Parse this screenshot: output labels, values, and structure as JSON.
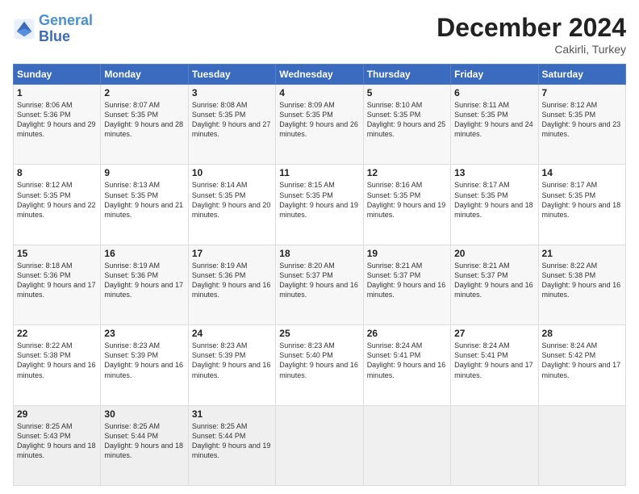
{
  "logo": {
    "line1": "General",
    "line2": "Blue"
  },
  "title": "December 2024",
  "subtitle": "Cakirli, Turkey",
  "days_header": [
    "Sunday",
    "Monday",
    "Tuesday",
    "Wednesday",
    "Thursday",
    "Friday",
    "Saturday"
  ],
  "weeks": [
    [
      {
        "day": "1",
        "sunrise": "Sunrise: 8:06 AM",
        "sunset": "Sunset: 5:36 PM",
        "daylight": "Daylight: 9 hours and 29 minutes."
      },
      {
        "day": "2",
        "sunrise": "Sunrise: 8:07 AM",
        "sunset": "Sunset: 5:35 PM",
        "daylight": "Daylight: 9 hours and 28 minutes."
      },
      {
        "day": "3",
        "sunrise": "Sunrise: 8:08 AM",
        "sunset": "Sunset: 5:35 PM",
        "daylight": "Daylight: 9 hours and 27 minutes."
      },
      {
        "day": "4",
        "sunrise": "Sunrise: 8:09 AM",
        "sunset": "Sunset: 5:35 PM",
        "daylight": "Daylight: 9 hours and 26 minutes."
      },
      {
        "day": "5",
        "sunrise": "Sunrise: 8:10 AM",
        "sunset": "Sunset: 5:35 PM",
        "daylight": "Daylight: 9 hours and 25 minutes."
      },
      {
        "day": "6",
        "sunrise": "Sunrise: 8:11 AM",
        "sunset": "Sunset: 5:35 PM",
        "daylight": "Daylight: 9 hours and 24 minutes."
      },
      {
        "day": "7",
        "sunrise": "Sunrise: 8:12 AM",
        "sunset": "Sunset: 5:35 PM",
        "daylight": "Daylight: 9 hours and 23 minutes."
      }
    ],
    [
      {
        "day": "8",
        "sunrise": "Sunrise: 8:12 AM",
        "sunset": "Sunset: 5:35 PM",
        "daylight": "Daylight: 9 hours and 22 minutes."
      },
      {
        "day": "9",
        "sunrise": "Sunrise: 8:13 AM",
        "sunset": "Sunset: 5:35 PM",
        "daylight": "Daylight: 9 hours and 21 minutes."
      },
      {
        "day": "10",
        "sunrise": "Sunrise: 8:14 AM",
        "sunset": "Sunset: 5:35 PM",
        "daylight": "Daylight: 9 hours and 20 minutes."
      },
      {
        "day": "11",
        "sunrise": "Sunrise: 8:15 AM",
        "sunset": "Sunset: 5:35 PM",
        "daylight": "Daylight: 9 hours and 19 minutes."
      },
      {
        "day": "12",
        "sunrise": "Sunrise: 8:16 AM",
        "sunset": "Sunset: 5:35 PM",
        "daylight": "Daylight: 9 hours and 19 minutes."
      },
      {
        "day": "13",
        "sunrise": "Sunrise: 8:17 AM",
        "sunset": "Sunset: 5:35 PM",
        "daylight": "Daylight: 9 hours and 18 minutes."
      },
      {
        "day": "14",
        "sunrise": "Sunrise: 8:17 AM",
        "sunset": "Sunset: 5:35 PM",
        "daylight": "Daylight: 9 hours and 18 minutes."
      }
    ],
    [
      {
        "day": "15",
        "sunrise": "Sunrise: 8:18 AM",
        "sunset": "Sunset: 5:36 PM",
        "daylight": "Daylight: 9 hours and 17 minutes."
      },
      {
        "day": "16",
        "sunrise": "Sunrise: 8:19 AM",
        "sunset": "Sunset: 5:36 PM",
        "daylight": "Daylight: 9 hours and 17 minutes."
      },
      {
        "day": "17",
        "sunrise": "Sunrise: 8:19 AM",
        "sunset": "Sunset: 5:36 PM",
        "daylight": "Daylight: 9 hours and 16 minutes."
      },
      {
        "day": "18",
        "sunrise": "Sunrise: 8:20 AM",
        "sunset": "Sunset: 5:37 PM",
        "daylight": "Daylight: 9 hours and 16 minutes."
      },
      {
        "day": "19",
        "sunrise": "Sunrise: 8:21 AM",
        "sunset": "Sunset: 5:37 PM",
        "daylight": "Daylight: 9 hours and 16 minutes."
      },
      {
        "day": "20",
        "sunrise": "Sunrise: 8:21 AM",
        "sunset": "Sunset: 5:37 PM",
        "daylight": "Daylight: 9 hours and 16 minutes."
      },
      {
        "day": "21",
        "sunrise": "Sunrise: 8:22 AM",
        "sunset": "Sunset: 5:38 PM",
        "daylight": "Daylight: 9 hours and 16 minutes."
      }
    ],
    [
      {
        "day": "22",
        "sunrise": "Sunrise: 8:22 AM",
        "sunset": "Sunset: 5:38 PM",
        "daylight": "Daylight: 9 hours and 16 minutes."
      },
      {
        "day": "23",
        "sunrise": "Sunrise: 8:23 AM",
        "sunset": "Sunset: 5:39 PM",
        "daylight": "Daylight: 9 hours and 16 minutes."
      },
      {
        "day": "24",
        "sunrise": "Sunrise: 8:23 AM",
        "sunset": "Sunset: 5:39 PM",
        "daylight": "Daylight: 9 hours and 16 minutes."
      },
      {
        "day": "25",
        "sunrise": "Sunrise: 8:23 AM",
        "sunset": "Sunset: 5:40 PM",
        "daylight": "Daylight: 9 hours and 16 minutes."
      },
      {
        "day": "26",
        "sunrise": "Sunrise: 8:24 AM",
        "sunset": "Sunset: 5:41 PM",
        "daylight": "Daylight: 9 hours and 16 minutes."
      },
      {
        "day": "27",
        "sunrise": "Sunrise: 8:24 AM",
        "sunset": "Sunset: 5:41 PM",
        "daylight": "Daylight: 9 hours and 17 minutes."
      },
      {
        "day": "28",
        "sunrise": "Sunrise: 8:24 AM",
        "sunset": "Sunset: 5:42 PM",
        "daylight": "Daylight: 9 hours and 17 minutes."
      }
    ],
    [
      {
        "day": "29",
        "sunrise": "Sunrise: 8:25 AM",
        "sunset": "Sunset: 5:43 PM",
        "daylight": "Daylight: 9 hours and 18 minutes."
      },
      {
        "day": "30",
        "sunrise": "Sunrise: 8:25 AM",
        "sunset": "Sunset: 5:44 PM",
        "daylight": "Daylight: 9 hours and 18 minutes."
      },
      {
        "day": "31",
        "sunrise": "Sunrise: 8:25 AM",
        "sunset": "Sunset: 5:44 PM",
        "daylight": "Daylight: 9 hours and 19 minutes."
      },
      null,
      null,
      null,
      null
    ]
  ]
}
